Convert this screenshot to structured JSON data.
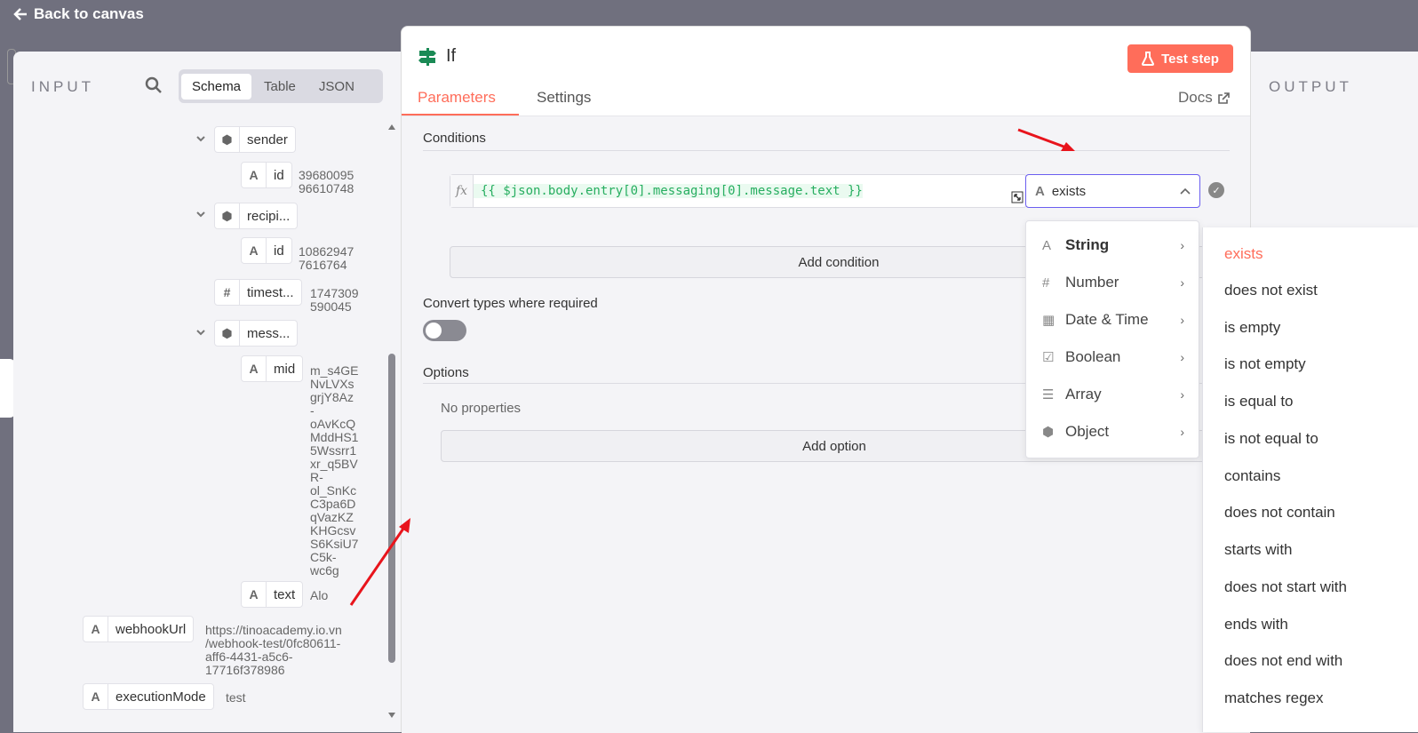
{
  "topbar": {
    "back_label": "Back to canvas"
  },
  "input": {
    "title": "INPUT",
    "views": [
      "Schema",
      "Table",
      "JSON"
    ],
    "active_view": "Schema",
    "schema": {
      "sender": {
        "key": "sender",
        "id_key": "id",
        "id_value": "39680095\n96610748"
      },
      "recipient": {
        "key": "recipi...",
        "id_key": "id",
        "id_value": "10862947\n7616764"
      },
      "timestamp": {
        "key": "timest...",
        "value": "1747309\n590045"
      },
      "message": {
        "key": "mess...",
        "mid_key": "mid",
        "mid_value": "m_s4GE\nNvLVXs\ngrjY8Az\n-\noAvKcQ\nMddHS1\n5Wssrr1\nxr_q5BV\nR-\nol_SnKc\nC3pa6D\nqVazKZ\nKHGcsv\nS6KsiU7\nC5k-\nwc6g",
        "text_key": "text",
        "text_value": "Alo"
      },
      "webhookUrl": {
        "key": "webhookUrl",
        "value": "https://tinoacademy.io.vn\n/webhook-test/0fc80611-\naff6-4431-a5c6-\n17716f378986"
      },
      "executionMode": {
        "key": "executionMode",
        "value": "test"
      }
    }
  },
  "output": {
    "title": "OUTPUT"
  },
  "node": {
    "title": "If",
    "test_step_label": "Test step",
    "tabs": [
      "Parameters",
      "Settings"
    ],
    "docs_label": "Docs",
    "conditions_label": "Conditions",
    "expression": "{{ $json.body.entry[0].messaging[0].message.text }}",
    "operator_value": "exists",
    "add_condition_label": "Add condition",
    "convert_types_label": "Convert types where required",
    "convert_types_enabled": false,
    "options_label": "Options",
    "no_properties_label": "No properties",
    "add_option_label": "Add option"
  },
  "type_menu": {
    "items": [
      {
        "label": "String",
        "icon": "text-type-icon"
      },
      {
        "label": "Number",
        "icon": "hash-icon"
      },
      {
        "label": "Date & Time",
        "icon": "calendar-icon"
      },
      {
        "label": "Boolean",
        "icon": "checkbox-icon"
      },
      {
        "label": "Array",
        "icon": "list-icon"
      },
      {
        "label": "Object",
        "icon": "cube-icon"
      }
    ],
    "active": "String"
  },
  "operator_menu": {
    "items": [
      "exists",
      "does not exist",
      "is empty",
      "is not empty",
      "is equal to",
      "is not equal to",
      "contains",
      "does not contain",
      "starts with",
      "does not start with",
      "ends with",
      "does not end with",
      "matches regex"
    ],
    "selected": "exists"
  },
  "colors": {
    "accent": "#ff6d5a",
    "focus": "#6b5ef0",
    "expression": "#27ae60",
    "annotation_arrow": "#e8141c"
  }
}
